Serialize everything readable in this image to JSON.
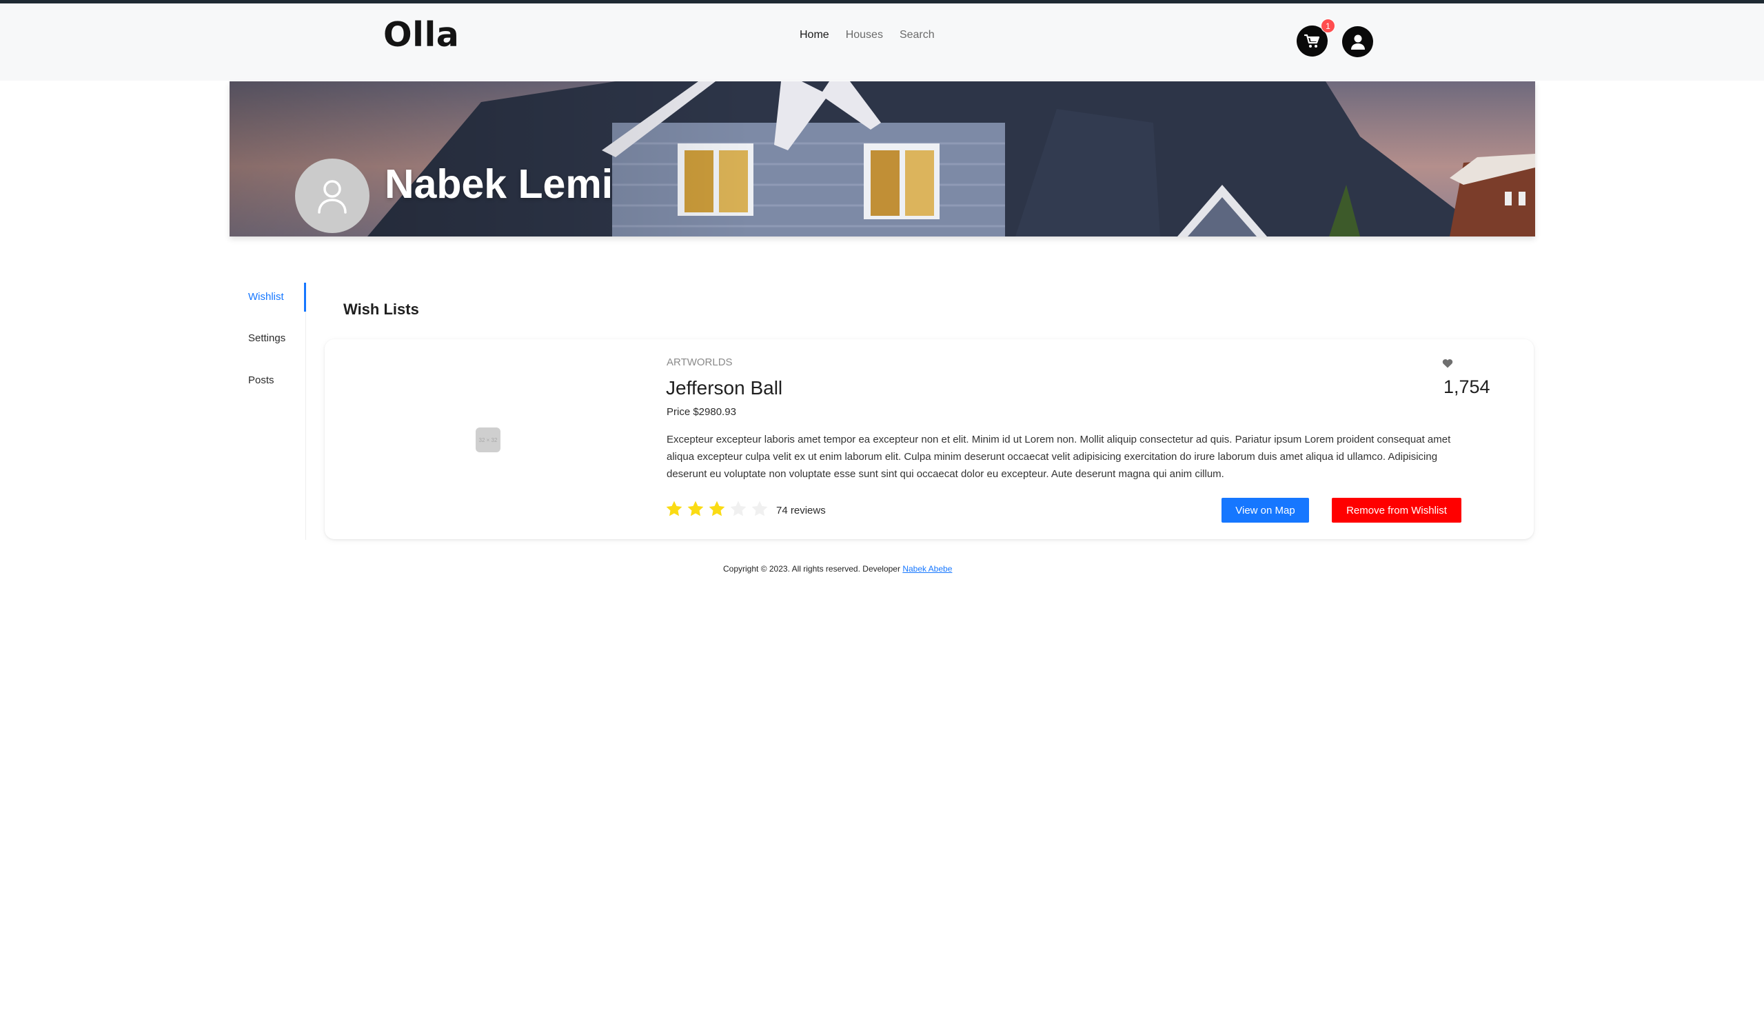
{
  "header": {
    "logo": "Olla",
    "nav": [
      {
        "label": "Home",
        "active": true
      },
      {
        "label": "Houses",
        "active": false
      },
      {
        "label": "Search",
        "active": false
      }
    ],
    "cart_count": "1",
    "cart_icon": "cart-icon",
    "user_icon": "user-icon"
  },
  "profile": {
    "name": "Nabek Lemi",
    "avatar_icon": "user-outline-icon"
  },
  "sidebar": {
    "items": [
      {
        "label": "Wishlist",
        "active": true
      },
      {
        "label": "Settings",
        "active": false
      },
      {
        "label": "Posts",
        "active": false
      }
    ]
  },
  "main": {
    "title": "Wish Lists",
    "items": [
      {
        "image_placeholder": "32 × 32",
        "brand": "ARTWORLDS",
        "name": "Jefferson Ball",
        "price": "Price $2980.93",
        "description": "Excepteur excepteur laboris amet tempor ea excepteur non et elit. Minim id ut Lorem non. Mollit aliquip consectetur ad quis. Pariatur ipsum Lorem proident consequat amet aliqua excepteur culpa velit ex ut enim laborum elit. Culpa minim deserunt occaecat velit adipisicing exercitation do irure laborum duis amet aliqua id ullamco. Adipisicing deserunt eu voluptate non voluptate esse sunt sint qui occaecat dolor eu excepteur. Aute deserunt magna qui anim cillum.",
        "likes": "1,754",
        "rating": 3,
        "rating_max": 5,
        "reviews": "74 reviews",
        "view_map_label": "View on Map",
        "remove_label": "Remove from Wishlist"
      }
    ]
  },
  "footer": {
    "text": "Copyright © 2023. All rights reserved. Developer",
    "link": "Nabek Abebe"
  },
  "colors": {
    "primary": "#1677ff",
    "danger": "#ff0000",
    "star": "#fadb14",
    "star_empty": "#f0f0f0",
    "badge": "#ff4d4f"
  }
}
